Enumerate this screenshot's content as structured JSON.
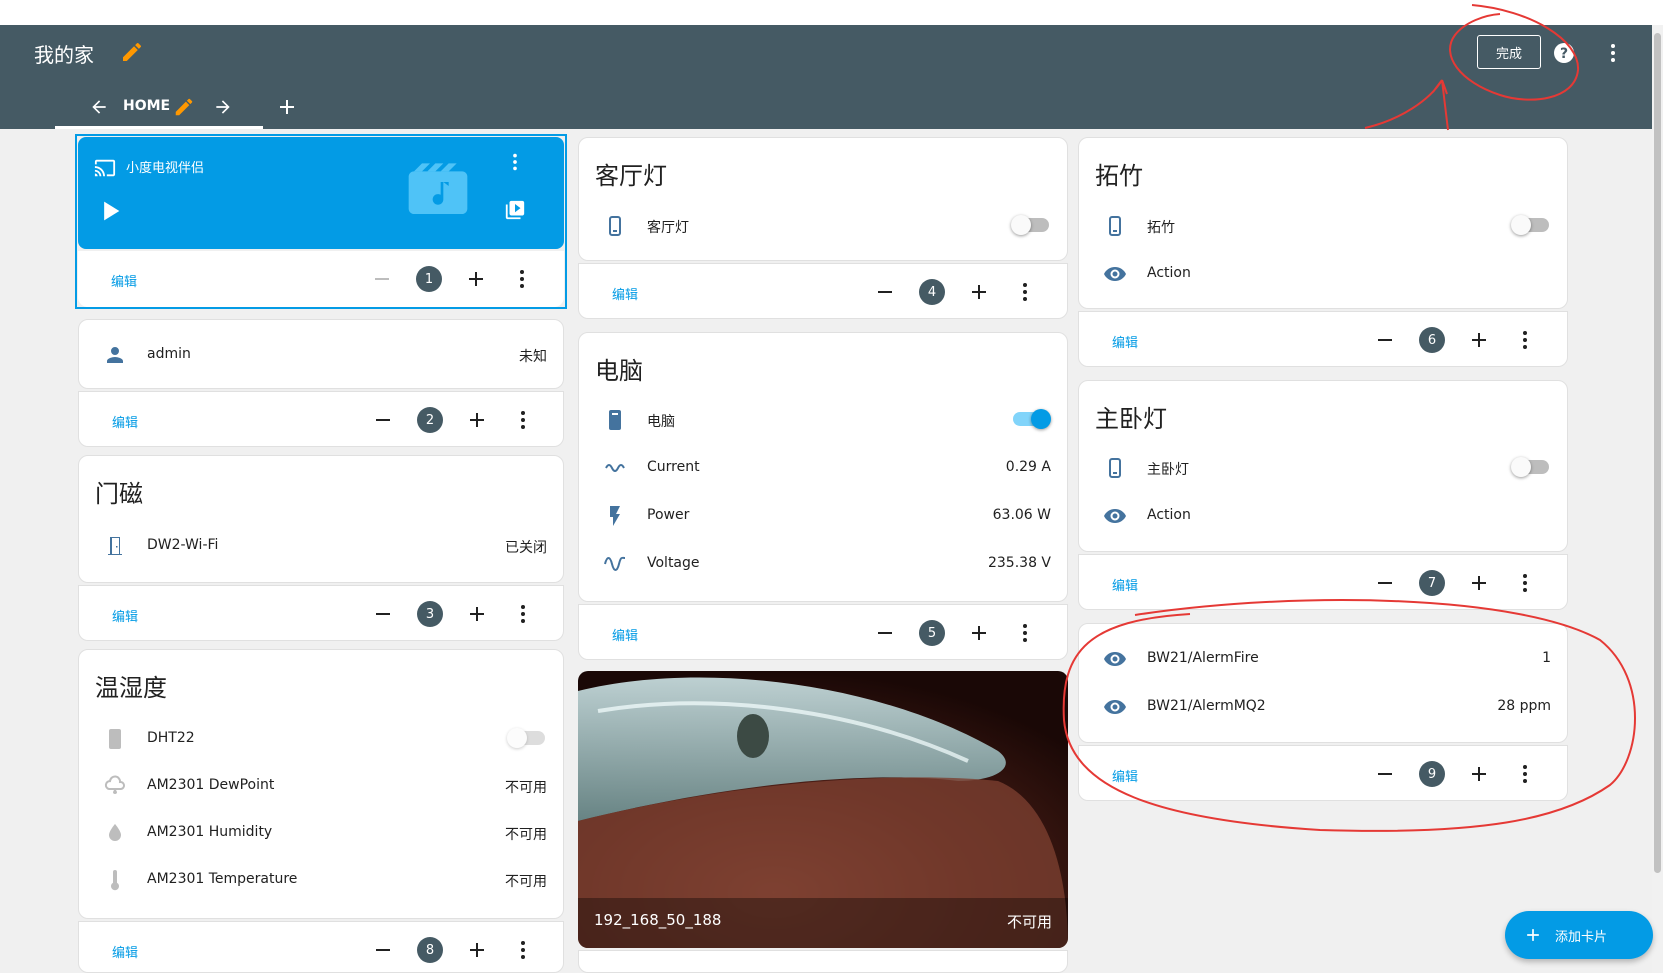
{
  "header": {
    "title": "我的家",
    "done_label": "完成",
    "tab_label": "HOME"
  },
  "colors": {
    "header_bg": "#455a64",
    "accent": "#039be5",
    "annotation": "#e53935"
  },
  "cards": {
    "media": {
      "name": "小度电视伴侣",
      "badge": "1"
    },
    "person": {
      "name": "admin",
      "state": "未知",
      "badge": "2"
    },
    "door": {
      "title": "门磁",
      "entity": "DW2-Wi-Fi",
      "state": "已关闭",
      "badge": "3"
    },
    "living_light": {
      "title": "客厅灯",
      "entity": "客厅灯",
      "badge": "4"
    },
    "computer": {
      "title": "电脑",
      "entity": "电脑",
      "badge": "5",
      "rows": [
        {
          "label": "Current",
          "value": "0.29 A"
        },
        {
          "label": "Power",
          "value": "63.06 W"
        },
        {
          "label": "Voltage",
          "value": "235.38 V"
        }
      ]
    },
    "tuozhu": {
      "title": "拓竹",
      "entity": "拓竹",
      "action": "Action",
      "badge": "6"
    },
    "bedroom_light": {
      "title": "主卧灯",
      "entity": "主卧灯",
      "action": "Action",
      "badge": "7"
    },
    "temp": {
      "title": "温湿度",
      "entity": "DHT22",
      "badge": "8",
      "rows": [
        {
          "label": "AM2301 DewPoint",
          "value": "不可用"
        },
        {
          "label": "AM2301 Humidity",
          "value": "不可用"
        },
        {
          "label": "AM2301 Temperature",
          "value": "不可用"
        }
      ]
    },
    "bw21": {
      "badge": "9",
      "rows": [
        {
          "label": "BW21/AlermFire",
          "value": "1"
        },
        {
          "label": "BW21/AlermMQ2",
          "value": "28 ppm"
        }
      ]
    },
    "camera": {
      "name": "192_168_50_188",
      "state": "不可用"
    }
  },
  "edit_label": "编辑",
  "fab_label": "添加卡片"
}
